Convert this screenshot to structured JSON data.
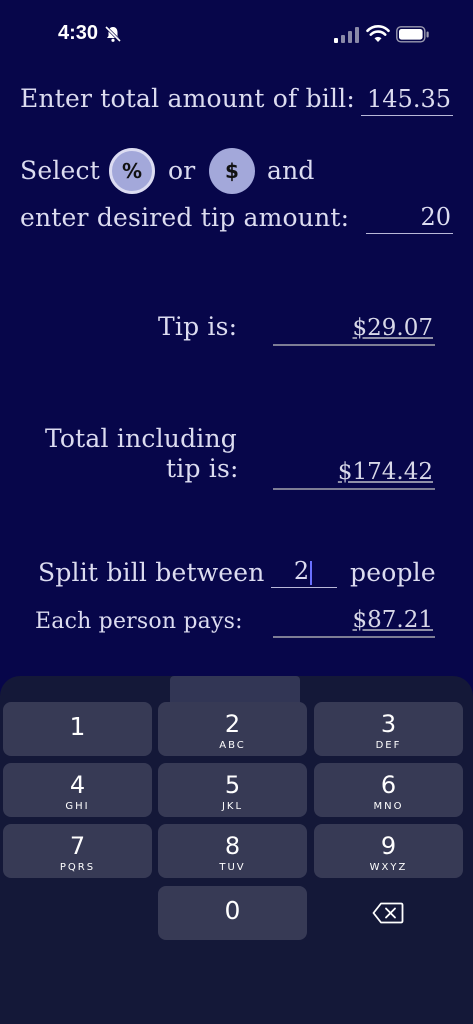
{
  "status": {
    "time": "4:30"
  },
  "bill": {
    "label": "Enter total amount of bill:",
    "value": "145.35"
  },
  "select": {
    "prefix": "Select",
    "or": "or",
    "and": "and",
    "pct_label": "%",
    "dollar_label": "$"
  },
  "tip_input": {
    "label": "enter desired tip amount:",
    "value": "20"
  },
  "tip": {
    "label": "Tip is:",
    "value": "$29.07"
  },
  "total": {
    "label_line1": "Total including",
    "label_line2": "tip is:",
    "value": "$174.42"
  },
  "split": {
    "label": "Split bill between",
    "value": "2",
    "suffix": "people"
  },
  "each": {
    "label": "Each person pays:",
    "value": "$87.21"
  },
  "keyboard": {
    "keys": [
      {
        "num": "1",
        "letters": ""
      },
      {
        "num": "2",
        "letters": "ABC"
      },
      {
        "num": "3",
        "letters": "DEF"
      },
      {
        "num": "4",
        "letters": "GHI"
      },
      {
        "num": "5",
        "letters": "JKL"
      },
      {
        "num": "6",
        "letters": "MNO"
      },
      {
        "num": "7",
        "letters": "PQRS"
      },
      {
        "num": "8",
        "letters": "TUV"
      },
      {
        "num": "9",
        "letters": "WXYZ"
      },
      {
        "num": "0",
        "letters": ""
      }
    ]
  }
}
